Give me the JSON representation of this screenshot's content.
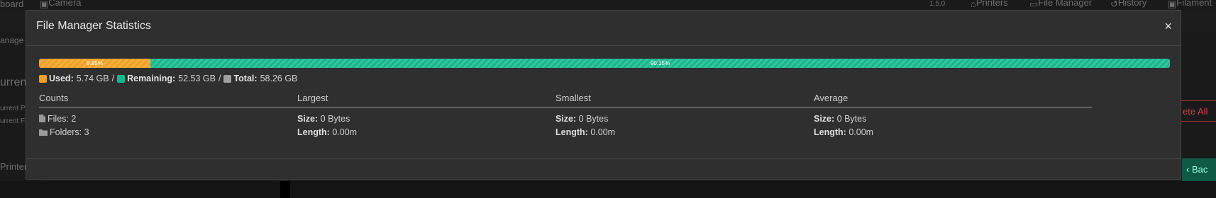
{
  "background": {
    "nav_left": [
      "board",
      "Camera"
    ],
    "version": "1.5.0",
    "nav_right": [
      "Printers",
      "File Manager",
      "History",
      "Filament"
    ],
    "side_texts": [
      "anage",
      "urren",
      "urrent P",
      "urrent F",
      "Printer"
    ],
    "delete_all": "ete All",
    "back": "Bac"
  },
  "modal": {
    "title": "File Manager Statistics",
    "close": "×"
  },
  "storage": {
    "used_percent_label": "9.85%",
    "remaining_percent_label": "90.15%",
    "used_fraction": 0.0985,
    "remaining_fraction": 0.9015,
    "used_color": "#f0a020",
    "remaining_color": "#16b88c",
    "total_color": "#a0a0a0",
    "used_label": "Used:",
    "used_value": "5.74 GB",
    "remaining_label": "Remaining:",
    "remaining_value": "52.53 GB",
    "total_label": "Total:",
    "total_value": "58.26 GB",
    "separator": "/"
  },
  "columns": {
    "counts": {
      "title": "Counts",
      "files_label": "Files:",
      "files_value": "2",
      "folders_label": "Folders:",
      "folders_value": "3",
      "files_icon": "file-icon",
      "folders_icon": "folder-icon"
    },
    "largest": {
      "title": "Largest",
      "size_label": "Size:",
      "size_value": "0 Bytes",
      "length_label": "Length:",
      "length_value": "0.00m"
    },
    "smallest": {
      "title": "Smallest",
      "size_label": "Size:",
      "size_value": "0 Bytes",
      "length_label": "Length:",
      "length_value": "0.00m"
    },
    "average": {
      "title": "Average",
      "size_label": "Size:",
      "size_value": "0 Bytes",
      "length_label": "Length:",
      "length_value": "0.00m"
    }
  }
}
